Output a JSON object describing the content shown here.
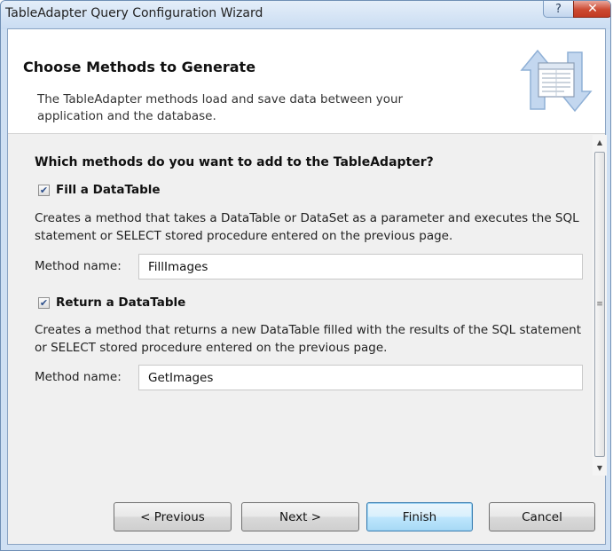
{
  "window": {
    "title": "TableAdapter Query Configuration Wizard",
    "help_label": "?",
    "close_label": "✕"
  },
  "header": {
    "title": "Choose Methods to Generate",
    "description": "The TableAdapter methods load and save data between your application and the database.",
    "icon": "table-sync-icon"
  },
  "content": {
    "question": "Which methods do you want to add to the TableAdapter?",
    "fill": {
      "checked": true,
      "label": "Fill a DataTable",
      "description": "Creates a method that takes a DataTable or DataSet as a parameter and executes the SQL statement or SELECT stored procedure entered on the previous page.",
      "method_label": "Method name:",
      "method_value": "FillImages"
    },
    "get": {
      "checked": true,
      "label": "Return a DataTable",
      "description": "Creates a method that returns a new DataTable filled with the results of the SQL statement or SELECT stored procedure entered on the previous page.",
      "method_label": "Method name:",
      "method_value": "GetImages"
    }
  },
  "footer": {
    "previous_label": "< Previous",
    "next_label": "Next >",
    "finish_label": "Finish",
    "cancel_label": "Cancel"
  },
  "colors": {
    "titlebar": "#c9dcf2",
    "close_button": "#c23a22",
    "default_button_border": "#3c7fb1"
  }
}
